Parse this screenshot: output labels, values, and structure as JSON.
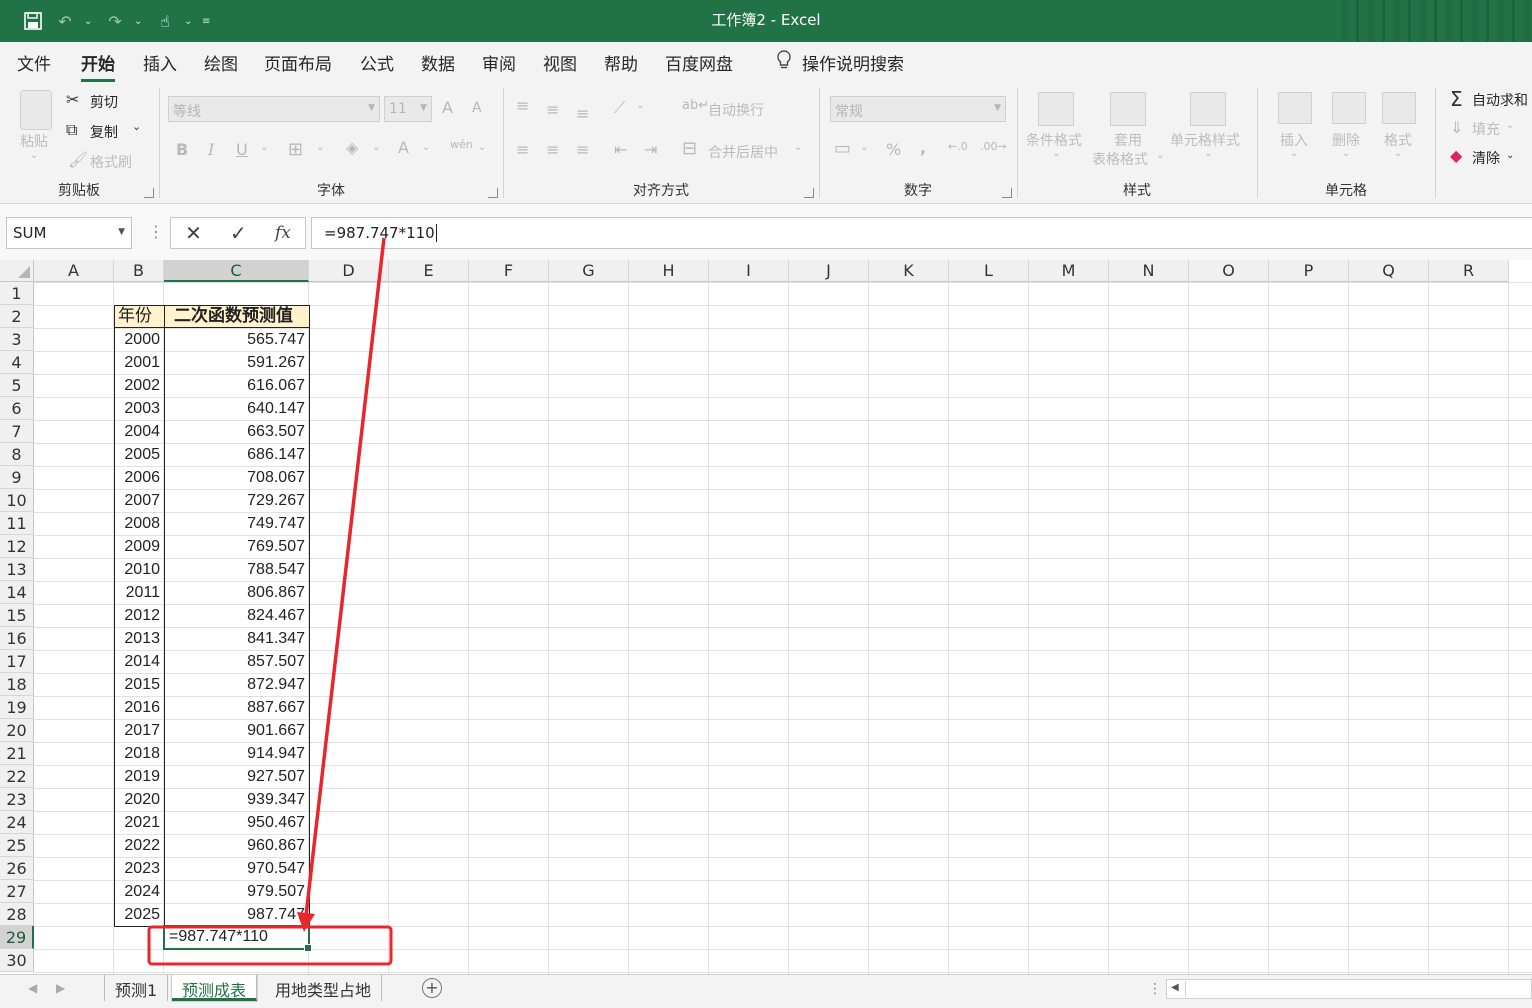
{
  "window": {
    "title": "工作簿2  -  Excel"
  },
  "quick_access": {
    "icons": [
      "save-icon",
      "undo-icon",
      "redo-icon",
      "touch-mode-icon",
      "customize-icon"
    ]
  },
  "menu": {
    "tabs": [
      "文件",
      "开始",
      "插入",
      "绘图",
      "页面布局",
      "公式",
      "数据",
      "审阅",
      "视图",
      "帮助",
      "百度网盘"
    ],
    "active": "开始",
    "tell_me": "操作说明搜索"
  },
  "ribbon": {
    "clipboard": {
      "label": "剪贴板",
      "paste": "粘贴",
      "cut": "剪切",
      "copy": "复制",
      "format_painter": "格式刷"
    },
    "font": {
      "label": "字体",
      "font_name": "等线",
      "font_size": "11",
      "bold": "B",
      "italic": "I",
      "underline": "U",
      "grow": "A",
      "shrink": "A",
      "color": "A",
      "phonetic": "wén"
    },
    "alignment": {
      "label": "对齐方式",
      "wrap": "自动换行",
      "merge": "合并后居中"
    },
    "number": {
      "label": "数字",
      "format": "常规",
      "percent": "%",
      "comma": ","
    },
    "styles": {
      "label": "样式",
      "conditional": "条件格式",
      "table_line1": "套用",
      "table_line2": "表格格式",
      "cell_styles": "单元格样式"
    },
    "cells": {
      "label": "单元格",
      "insert": "插入",
      "delete": "删除",
      "format": "格式"
    },
    "editing": {
      "autosum": "自动求和",
      "fill": "填充",
      "clear": "清除"
    }
  },
  "formula_bar": {
    "name_box": "SUM",
    "cancel": "✕",
    "enter": "✓",
    "fx": "fx",
    "content": "=987.747*110"
  },
  "columns": [
    "A",
    "B",
    "C",
    "D",
    "E",
    "F",
    "G",
    "H",
    "I",
    "J",
    "K",
    "L",
    "M",
    "N",
    "O",
    "P",
    "Q",
    "R"
  ],
  "rows": [
    "1",
    "2",
    "3",
    "4",
    "5",
    "6",
    "7",
    "8",
    "9",
    "10",
    "11",
    "12",
    "13",
    "14",
    "15",
    "16",
    "17",
    "18",
    "19",
    "20",
    "21",
    "22",
    "23",
    "24",
    "25",
    "26",
    "27",
    "28",
    "29",
    "30"
  ],
  "table": {
    "header_year": "年份",
    "header_value": "二次函数预测值",
    "years": [
      "2000",
      "2001",
      "2002",
      "2003",
      "2004",
      "2005",
      "2006",
      "2007",
      "2008",
      "2009",
      "2010",
      "2011",
      "2012",
      "2013",
      "2014",
      "2015",
      "2016",
      "2017",
      "2018",
      "2019",
      "2020",
      "2021",
      "2022",
      "2023",
      "2024",
      "2025"
    ],
    "values": [
      "565.747",
      "591.267",
      "616.067",
      "640.147",
      "663.507",
      "686.147",
      "708.067",
      "729.267",
      "749.747",
      "769.507",
      "788.547",
      "806.867",
      "824.467",
      "841.347",
      "857.507",
      "872.947",
      "887.667",
      "901.667",
      "914.947",
      "927.507",
      "939.347",
      "950.467",
      "960.867",
      "970.547",
      "979.507",
      "987.747"
    ]
  },
  "active_cell": {
    "address": "C29",
    "text": "=987.747*110"
  },
  "sheets": {
    "tabs": [
      "预测1",
      "预测成表",
      "用地类型占地"
    ],
    "active": "预测成表"
  },
  "annotation_color": "#e8262b"
}
